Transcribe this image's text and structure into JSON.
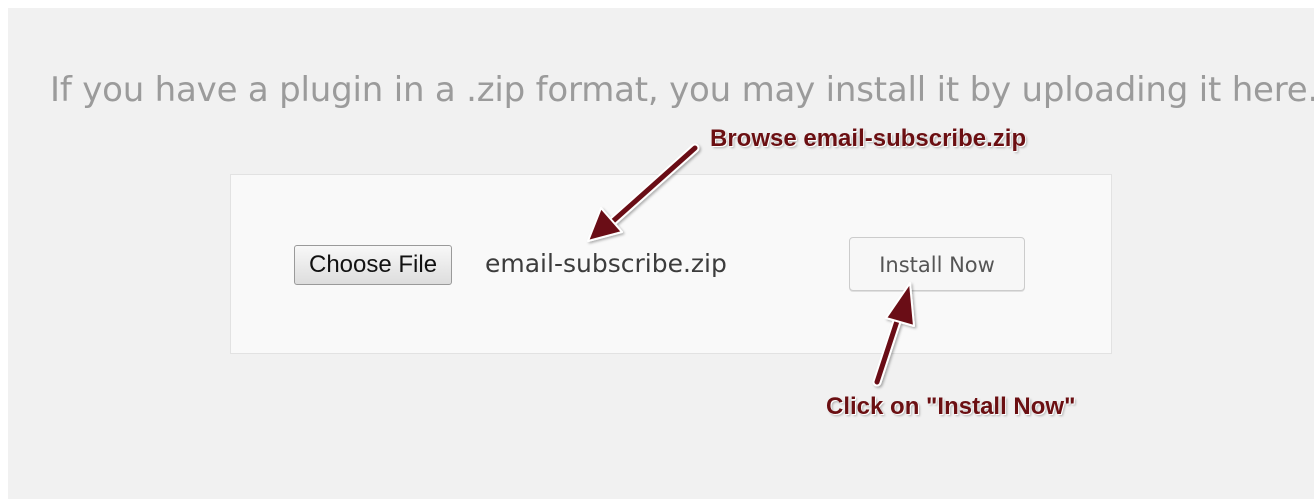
{
  "intro_text": "If you have a plugin in a .zip format, you may install it by uploading it here.",
  "upload": {
    "choose_button_label": "Choose File",
    "selected_file": "email-subscribe.zip",
    "install_button_label": "Install Now"
  },
  "annotations": {
    "browse": "Browse email-subscribe.zip",
    "click": "Click on \"Install Now\""
  },
  "colors": {
    "annotation": "#6b0f12",
    "background": "#f1f1f1",
    "panel": "#f9f9f9"
  }
}
